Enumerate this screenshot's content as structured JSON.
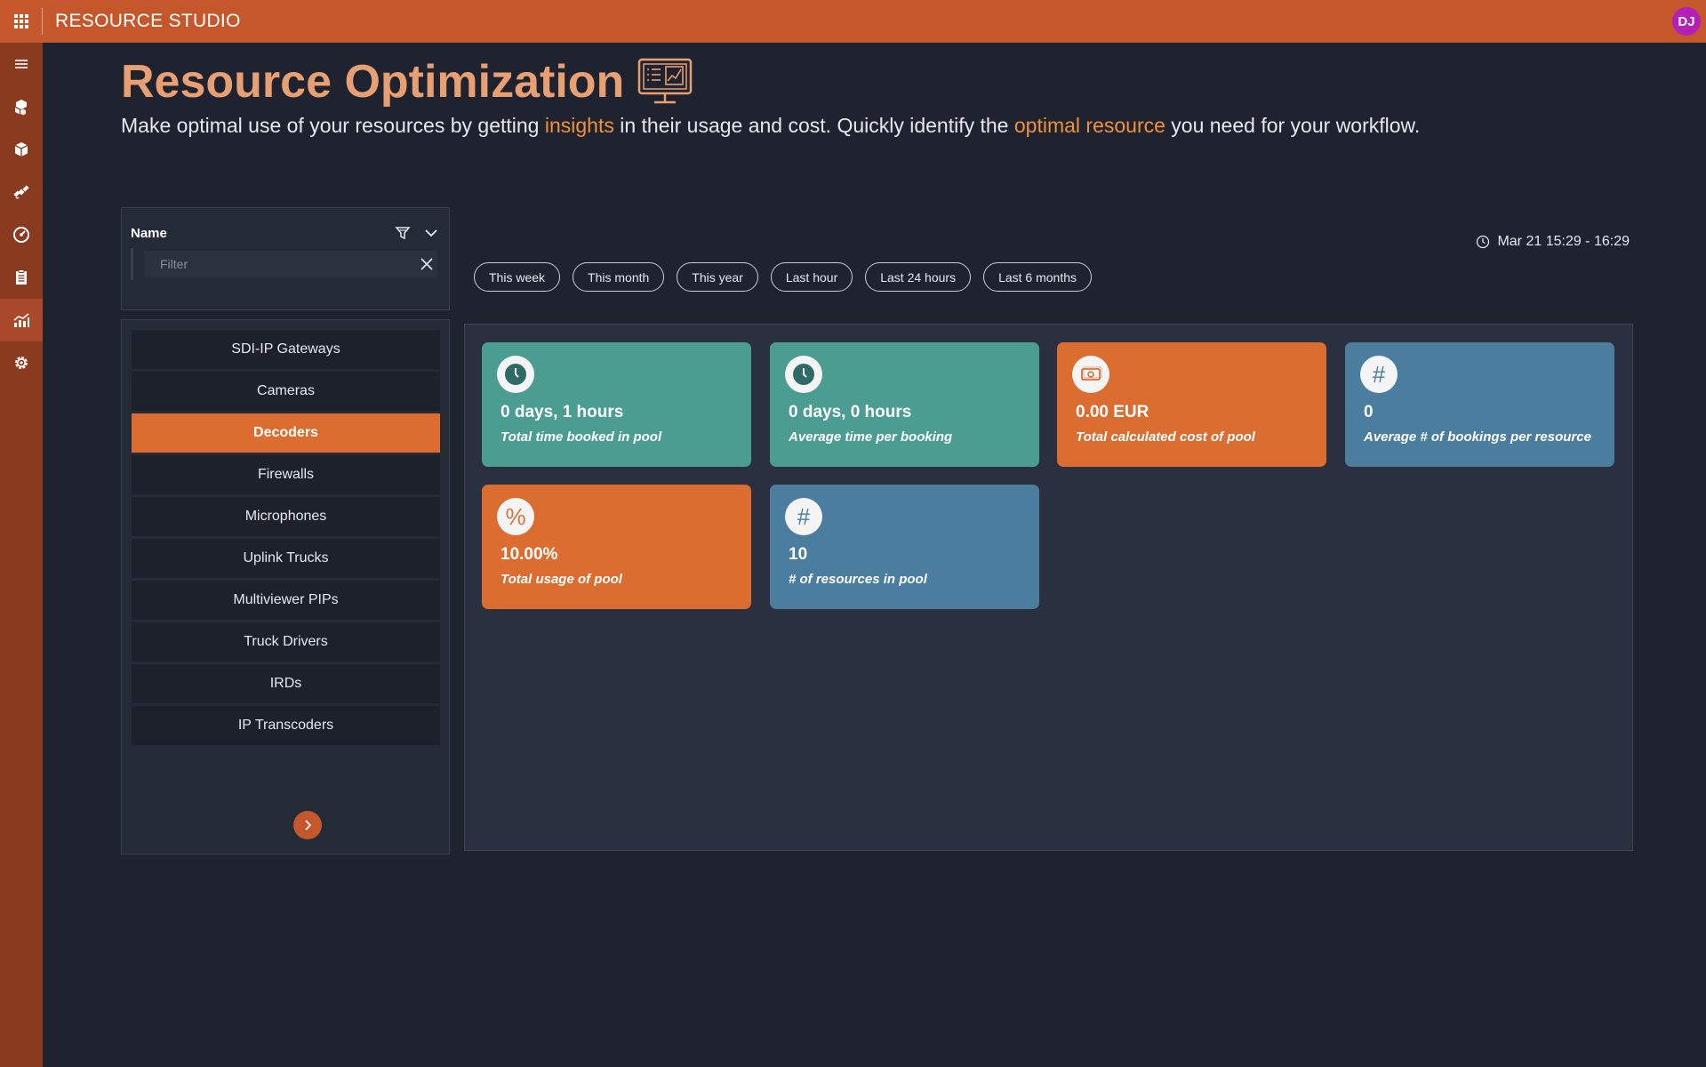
{
  "app": {
    "title": "RESOURCE STUDIO",
    "user_initials": "DJ"
  },
  "colors": {
    "topbar": "#c4572b",
    "rail": "#8a3a1f",
    "accent": "#db6d31",
    "teal": "#4b9d92",
    "blue": "#4a7d9e",
    "highlight": "#f0913d"
  },
  "rail": {
    "items": [
      {
        "icon": "menu-icon"
      },
      {
        "icon": "cubes-icon"
      },
      {
        "icon": "cube-icon"
      },
      {
        "icon": "satellite-icon"
      },
      {
        "icon": "gauge-icon"
      },
      {
        "icon": "clipboard-icon"
      },
      {
        "icon": "chart-icon",
        "active": true
      },
      {
        "icon": "gear-icon"
      }
    ]
  },
  "hero": {
    "title": "Resource Optimization",
    "sub_1": "Make optimal use of your resources by getting ",
    "sub_hl_1": "insights",
    "sub_2": " in their usage and cost. Quickly identify the ",
    "sub_hl_2": "optimal resource",
    "sub_3": " you need for your workflow."
  },
  "filter": {
    "label": "Name",
    "placeholder": "Filter"
  },
  "resources": {
    "items": [
      {
        "label": "SDI-IP Gateways"
      },
      {
        "label": "Cameras"
      },
      {
        "label": "Decoders",
        "selected": true
      },
      {
        "label": "Firewalls"
      },
      {
        "label": "Microphones"
      },
      {
        "label": "Uplink Trucks"
      },
      {
        "label": "Multiviewer PIPs"
      },
      {
        "label": "Truck Drivers"
      },
      {
        "label": "IRDs"
      },
      {
        "label": "IP Transcoders"
      }
    ]
  },
  "time": {
    "range": "Mar 21 15:29 - 16:29",
    "chips": [
      "This week",
      "This month",
      "This year",
      "Last hour",
      "Last 24 hours",
      "Last 6 months"
    ]
  },
  "stats": {
    "cards": [
      {
        "icon": "clock-icon",
        "value": "0 days, 1 hours",
        "label": "Total time booked in pool",
        "color": "teal"
      },
      {
        "icon": "clock-icon",
        "value": "0 days, 0 hours",
        "label": "Average time per booking",
        "color": "teal"
      },
      {
        "icon": "money-icon",
        "value": "0.00 EUR",
        "label": "Total calculated cost of pool",
        "color": "orange"
      },
      {
        "icon": "hash-icon",
        "value": "0",
        "label": "Average # of bookings per resource",
        "color": "blue"
      },
      {
        "icon": "percent-icon",
        "value": "10.00%",
        "label": "Total usage of pool",
        "color": "orange"
      },
      {
        "icon": "hash-icon",
        "value": "10",
        "label": "# of resources in pool",
        "color": "blue"
      }
    ]
  }
}
